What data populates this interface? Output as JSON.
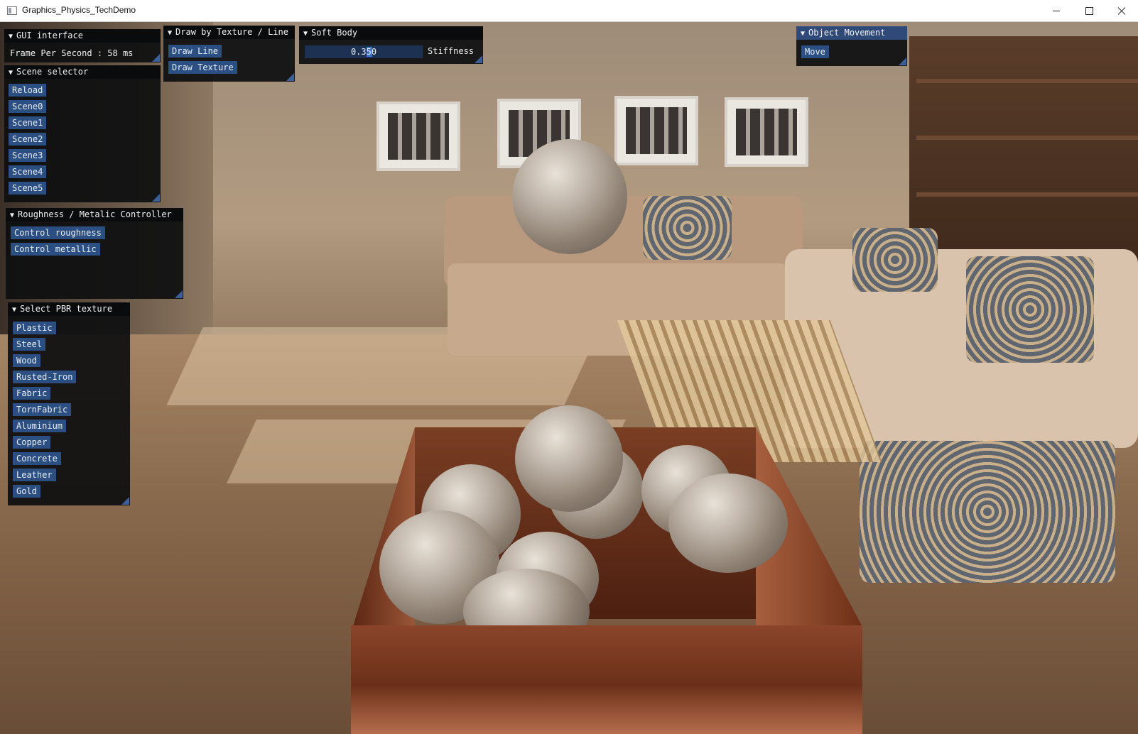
{
  "window": {
    "title": "Graphics_Physics_TechDemo"
  },
  "gui_interface": {
    "title": "GUI interface",
    "fps_text": "Frame Per Second : 58 ms"
  },
  "scene_selector": {
    "title": "Scene selector",
    "buttons": [
      "Reload",
      "Scene0",
      "Scene1",
      "Scene2",
      "Scene3",
      "Scene4",
      "Scene5"
    ]
  },
  "draw_panel": {
    "title": "Draw by Texture / Line",
    "buttons": [
      "Draw Line",
      "Draw Texture"
    ]
  },
  "soft_body": {
    "title": "Soft Body",
    "slider_value": "0.350",
    "slider_fraction": 0.35,
    "slider_label": "Stiffness"
  },
  "object_movement": {
    "title": "Object Movement",
    "buttons": [
      "Move"
    ]
  },
  "roughness_panel": {
    "title": "Roughness / Metalic Controller",
    "buttons": [
      "Control roughness",
      "Control metallic"
    ]
  },
  "pbr_panel": {
    "title": "Select PBR texture",
    "buttons": [
      "Plastic",
      "Steel",
      "Wood",
      "Rusted-Iron",
      "Fabric",
      "TornFabric",
      "Aluminium",
      "Copper",
      "Concrete",
      "Leather",
      "Gold"
    ]
  },
  "colors": {
    "panel_bg": "#0e0f10",
    "button": "#2b4f82",
    "title_active": "#2f4a78",
    "slider_bg": "#1d3252",
    "slider_grab": "#3f74c6"
  },
  "icons": {
    "collapse": "triangle-down-icon",
    "window": "app-icon",
    "minimize": "minimize-icon",
    "maximize": "maximize-icon",
    "close": "close-icon"
  }
}
